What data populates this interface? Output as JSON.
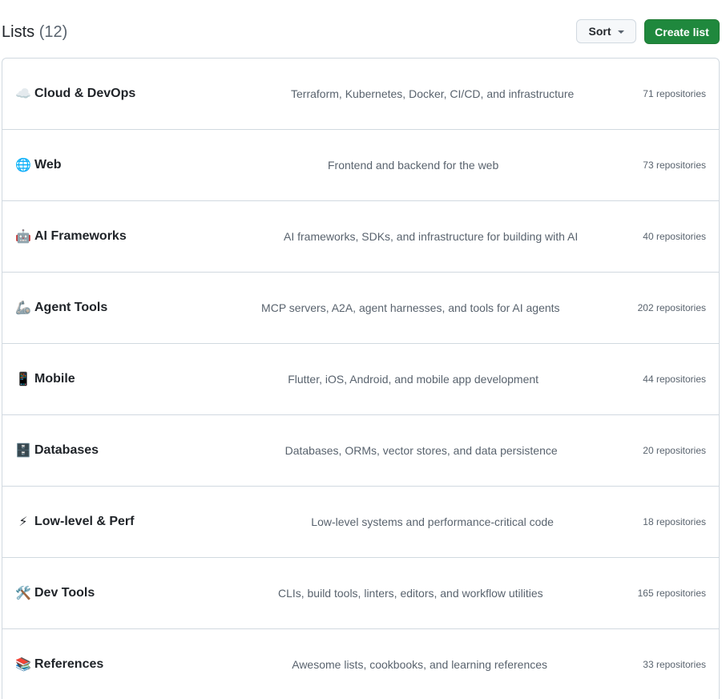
{
  "header": {
    "title": "Lists",
    "count": "(12)",
    "sort_label": "Sort",
    "create_label": "Create list"
  },
  "lists": [
    {
      "emoji": "☁️",
      "name": "Cloud & DevOps",
      "description": "Terraform, Kubernetes, Docker, CI/CD, and infrastructure",
      "count": "71 repositories"
    },
    {
      "emoji": "🌐",
      "name": "Web",
      "description": "Frontend and backend for the web",
      "count": "73 repositories"
    },
    {
      "emoji": "🤖",
      "name": "AI Frameworks",
      "description": "AI frameworks, SDKs, and infrastructure for building with AI",
      "count": "40 repositories"
    },
    {
      "emoji": "🦾",
      "name": "Agent Tools",
      "description": "MCP servers, A2A, agent harnesses, and tools for AI agents",
      "count": "202 repositories"
    },
    {
      "emoji": "📱",
      "name": "Mobile",
      "description": "Flutter, iOS, Android, and mobile app development",
      "count": "44 repositories"
    },
    {
      "emoji": "🗄️",
      "name": "Databases",
      "description": "Databases, ORMs, vector stores, and data persistence",
      "count": "20 repositories"
    },
    {
      "emoji": "⚡",
      "name": "Low-level & Perf",
      "description": "Low-level systems and performance-critical code",
      "count": "18 repositories"
    },
    {
      "emoji": "🛠️",
      "name": "Dev Tools",
      "description": "CLIs, build tools, linters, editors, and workflow utilities",
      "count": "165 repositories"
    },
    {
      "emoji": "📚",
      "name": "References",
      "description": "Awesome lists, cookbooks, and learning references",
      "count": "33 repositories"
    }
  ]
}
